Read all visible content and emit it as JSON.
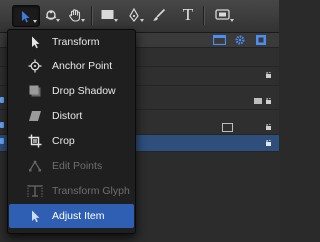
{
  "toolbar": {
    "buttons": [
      {
        "name": "select-transform-tool",
        "icon": "arrow-pointer-icon",
        "active": true
      },
      {
        "name": "orbit-tool",
        "icon": "orbit-icon"
      },
      {
        "name": "pan-tool",
        "icon": "hand-icon"
      },
      {
        "name": "shape-tool",
        "icon": "rectangle-icon"
      },
      {
        "name": "bezier-tool",
        "icon": "pen-icon"
      },
      {
        "name": "paint-stroke-tool",
        "icon": "paintbrush-icon"
      },
      {
        "name": "text-tool",
        "icon": "text-icon",
        "label": "T"
      },
      {
        "name": "mask-tool",
        "icon": "mask-rectangle-icon"
      }
    ]
  },
  "menu": {
    "items": [
      {
        "label": "Transform",
        "icon": "arrow-pointer-icon",
        "enabled": true,
        "selected": false
      },
      {
        "label": "Anchor Point",
        "icon": "anchor-point-icon",
        "enabled": true,
        "selected": false
      },
      {
        "label": "Drop Shadow",
        "icon": "drop-shadow-icon",
        "enabled": true,
        "selected": false
      },
      {
        "label": "Distort",
        "icon": "distort-icon",
        "enabled": true,
        "selected": false
      },
      {
        "label": "Crop",
        "icon": "crop-icon",
        "enabled": true,
        "selected": false
      },
      {
        "label": "Edit Points",
        "icon": "edit-points-icon",
        "enabled": false,
        "selected": false
      },
      {
        "label": "Transform Glyph",
        "icon": "transform-glyph-icon",
        "enabled": false,
        "selected": false
      },
      {
        "label": "Adjust Item",
        "icon": "arrow-pointer-icon",
        "enabled": true,
        "selected": true
      }
    ]
  },
  "colors": {
    "selection": "#2f5fb3",
    "selected_row": "#2e4f7c",
    "accent_blue": "#3d7be0"
  }
}
